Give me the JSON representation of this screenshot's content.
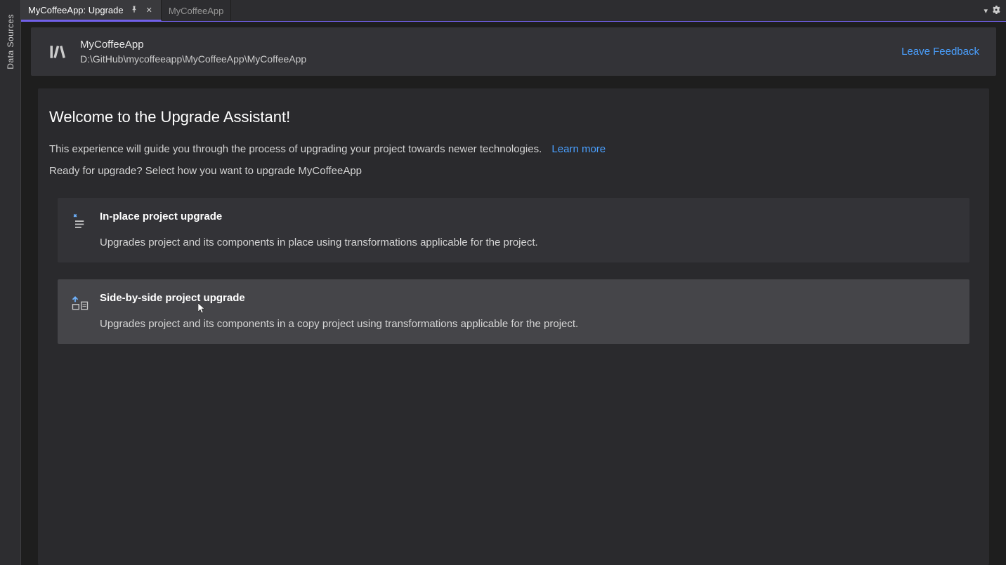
{
  "sidebar": {
    "data_sources_label": "Data Sources"
  },
  "tabs": [
    {
      "label": "MyCoffeeApp: Upgrade",
      "active": true
    },
    {
      "label": "MyCoffeeApp",
      "active": false
    }
  ],
  "project_header": {
    "name": "MyCoffeeApp",
    "path": "D:\\GitHub\\mycoffeeapp\\MyCoffeeApp\\MyCoffeeApp",
    "feedback_label": "Leave Feedback"
  },
  "panel": {
    "welcome_title": "Welcome to the Upgrade Assistant!",
    "intro_text": "This experience will guide you through the process of upgrading your project towards newer technologies.",
    "learn_more_label": "Learn more",
    "ready_text": "Ready for upgrade? Select how you want to upgrade MyCoffeeApp"
  },
  "options": [
    {
      "title": "In-place project upgrade",
      "description": "Upgrades project and its components in place using transformations applicable for the project.",
      "hovered": false
    },
    {
      "title": "Side-by-side project upgrade",
      "description": "Upgrades project and its components in a copy project using transformations applicable for the project.",
      "hovered": true
    }
  ]
}
